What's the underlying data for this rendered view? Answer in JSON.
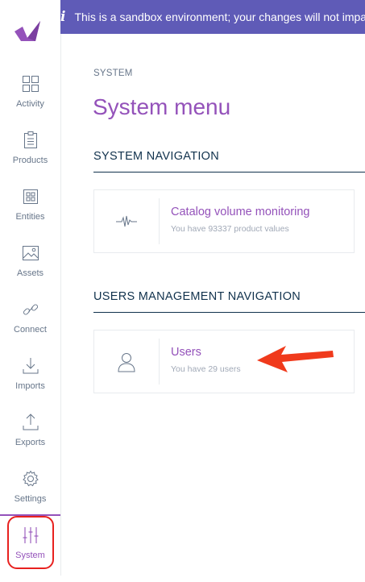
{
  "banner": {
    "message": "This is a sandbox environment; your changes will not impact your production data"
  },
  "sidebar": {
    "items": [
      {
        "label": "Activity"
      },
      {
        "label": "Products"
      },
      {
        "label": "Entities"
      },
      {
        "label": "Assets"
      },
      {
        "label": "Connect"
      },
      {
        "label": "Imports"
      },
      {
        "label": "Exports"
      },
      {
        "label": "Settings"
      },
      {
        "label": "System"
      }
    ],
    "active": "System"
  },
  "main": {
    "breadcrumb": "SYSTEM",
    "title": "System menu",
    "sections": [
      {
        "title": "SYSTEM NAVIGATION",
        "cards": [
          {
            "icon": "pulse-icon",
            "title": "Catalog volume monitoring",
            "subtitle": "You have 93337 product values"
          }
        ]
      },
      {
        "title": "USERS MANAGEMENT NAVIGATION",
        "cards": [
          {
            "icon": "user-icon",
            "title": "Users",
            "subtitle": "You have 29 users"
          }
        ]
      }
    ]
  },
  "colors": {
    "brand": "#9452ba",
    "banner": "#5f5bb7",
    "annotation": "#e8211f"
  }
}
